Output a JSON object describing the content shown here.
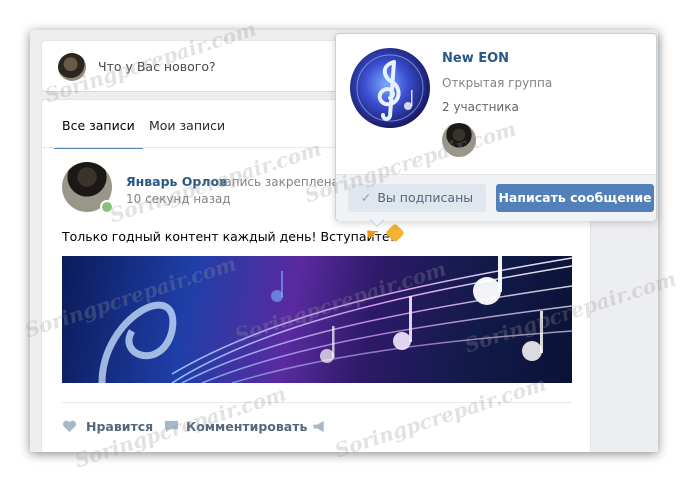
{
  "compose": {
    "placeholder": "Что у Вас нового?",
    "avatar_icon": "user-avatar"
  },
  "feed": {
    "tabs": [
      {
        "label": "Все записи",
        "active": true
      },
      {
        "label": "Мои записи",
        "active": false
      }
    ],
    "post": {
      "author": "Январь Орлов",
      "pinned_label": "запись закреплена",
      "time": "10 секунд назад",
      "text": "Только годный контент каждый день! Вступайте!",
      "emojis": [
        "point-right-emoji",
        "award-emoji"
      ],
      "image_icon": "music-notes-image",
      "online": true,
      "actions": {
        "like": "Нравится",
        "comment": "Комментировать"
      }
    }
  },
  "popup": {
    "group_name": "New EON",
    "group_type": "Открытая группа",
    "members": "2 участника",
    "subscribed_label": "Вы подписаны",
    "message_label": "Написать сообщение"
  },
  "colors": {
    "accent": "#5181b8",
    "link": "#2a5885",
    "online": "#8ac176",
    "background": "#edeef0"
  },
  "watermark": "Soringpcrepair.com"
}
